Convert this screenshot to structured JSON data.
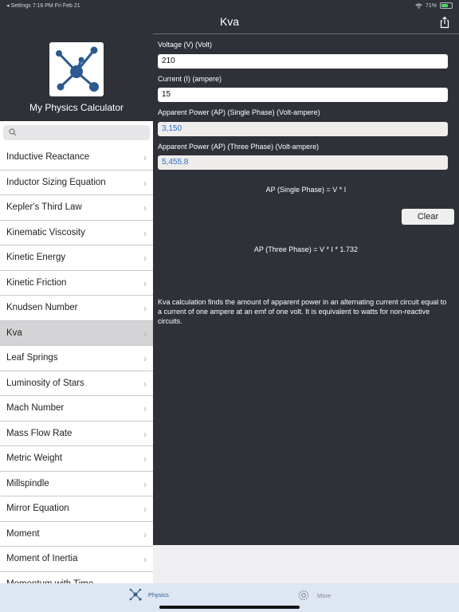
{
  "status": {
    "time_label": "◂ Settings  7:16 PM  Fri Feb 21",
    "battery": "71%"
  },
  "header": {
    "title": "Kva"
  },
  "sidebar": {
    "app_name": "My Physics Calculator",
    "search_placeholder": "",
    "items": [
      {
        "label": "Inductive Reactance"
      },
      {
        "label": "Inductor Sizing Equation"
      },
      {
        "label": "Kepler's Third Law"
      },
      {
        "label": "Kinematic Viscosity"
      },
      {
        "label": "Kinetic Energy"
      },
      {
        "label": "Kinetic Friction"
      },
      {
        "label": "Knudsen Number"
      },
      {
        "label": "Kva"
      },
      {
        "label": "Leaf Springs"
      },
      {
        "label": "Luminosity of Stars"
      },
      {
        "label": "Mach Number"
      },
      {
        "label": "Mass Flow Rate"
      },
      {
        "label": "Metric Weight"
      },
      {
        "label": "Millspindle"
      },
      {
        "label": "Mirror Equation"
      },
      {
        "label": "Moment"
      },
      {
        "label": "Moment of Inertia"
      },
      {
        "label": "Momentum with Time"
      }
    ],
    "selected": "Kva"
  },
  "form": {
    "voltage_label": "Voltage (V) (Volt)",
    "voltage_value": "210",
    "current_label": "Current (I) (ampere)",
    "current_value": "15",
    "ap_single_label": "Apparent Power (AP) (Single Phase) (Volt-ampere)",
    "ap_single_value": "3,150",
    "ap_three_label": "Apparent Power (AP) (Three Phase) (Volt-ampere)",
    "ap_three_value": "5,455.8",
    "formula_single": "AP (Single Phase) = V * I",
    "formula_three": "AP (Three Phase) = V * I * 1.732",
    "clear_label": "Clear",
    "description": "Kva calculation finds the amount of apparent power in an alternating current circuit equal to a current of one ampere at an emf of one volt. It is equivalent to watts for non-reactive circuits."
  },
  "tabs": [
    {
      "label": "Physics",
      "icon": "atom-icon"
    },
    {
      "label": "More",
      "icon": "gear-icon"
    }
  ]
}
